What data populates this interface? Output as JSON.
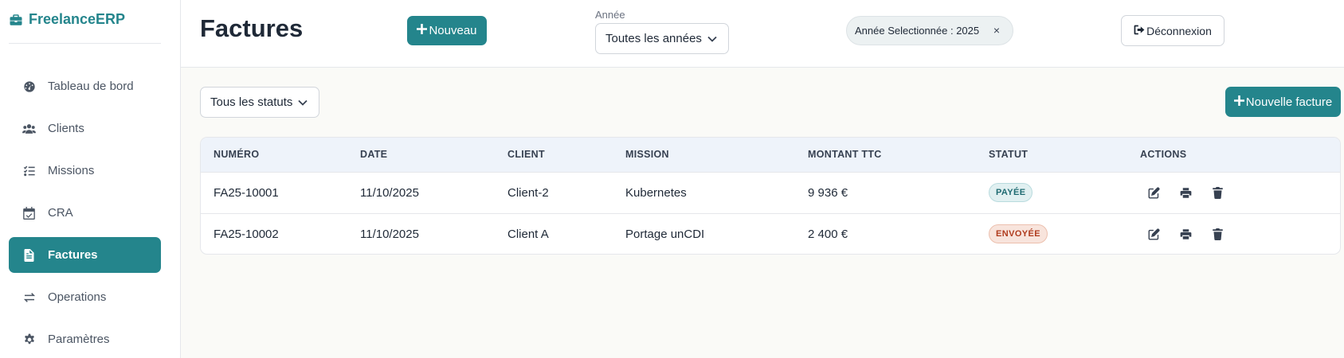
{
  "app": {
    "brand": "FreelanceERP"
  },
  "sidebar": {
    "items": [
      {
        "label": "Tableau de bord",
        "icon": "dashboard-icon",
        "active": false
      },
      {
        "label": "Clients",
        "icon": "users-icon",
        "active": false
      },
      {
        "label": "Missions",
        "icon": "tasks-icon",
        "active": false
      },
      {
        "label": "CRA",
        "icon": "calendar-check-icon",
        "active": false
      },
      {
        "label": "Factures",
        "icon": "invoice-icon",
        "active": true
      },
      {
        "label": "Operations",
        "icon": "transfer-icon",
        "active": false
      },
      {
        "label": "Paramètres",
        "icon": "gear-icon",
        "active": false
      }
    ]
  },
  "header": {
    "title": "Factures",
    "new_button": "Nouveau",
    "year_label": "Année",
    "year_select": "Toutes les années",
    "year_chip": "Année Selectionnée : 2025",
    "chip_close": "×",
    "logout_button": "Déconnexion"
  },
  "filters": {
    "status_select": "Tous les statuts",
    "new_invoice_button": "Nouvelle facture"
  },
  "table": {
    "columns": [
      "NUMÉRO",
      "DATE",
      "CLIENT",
      "MISSION",
      "MONTANT TTC",
      "STATUT",
      "ACTIONS"
    ],
    "rows": [
      {
        "numero": "FA25-10001",
        "date": "11/10/2025",
        "client": "Client-2",
        "mission": "Kubernetes",
        "montant": "9 936 €",
        "statut": "PAYÉE"
      },
      {
        "numero": "FA25-10002",
        "date": "11/10/2025",
        "client": "Client A",
        "mission": "Portage unCDI",
        "montant": "2 400 €",
        "statut": "ENVOYÉE"
      }
    ]
  },
  "colors": {
    "accent": "#24858c",
    "paid": "#1f6b72",
    "sent": "#b03c1e"
  }
}
